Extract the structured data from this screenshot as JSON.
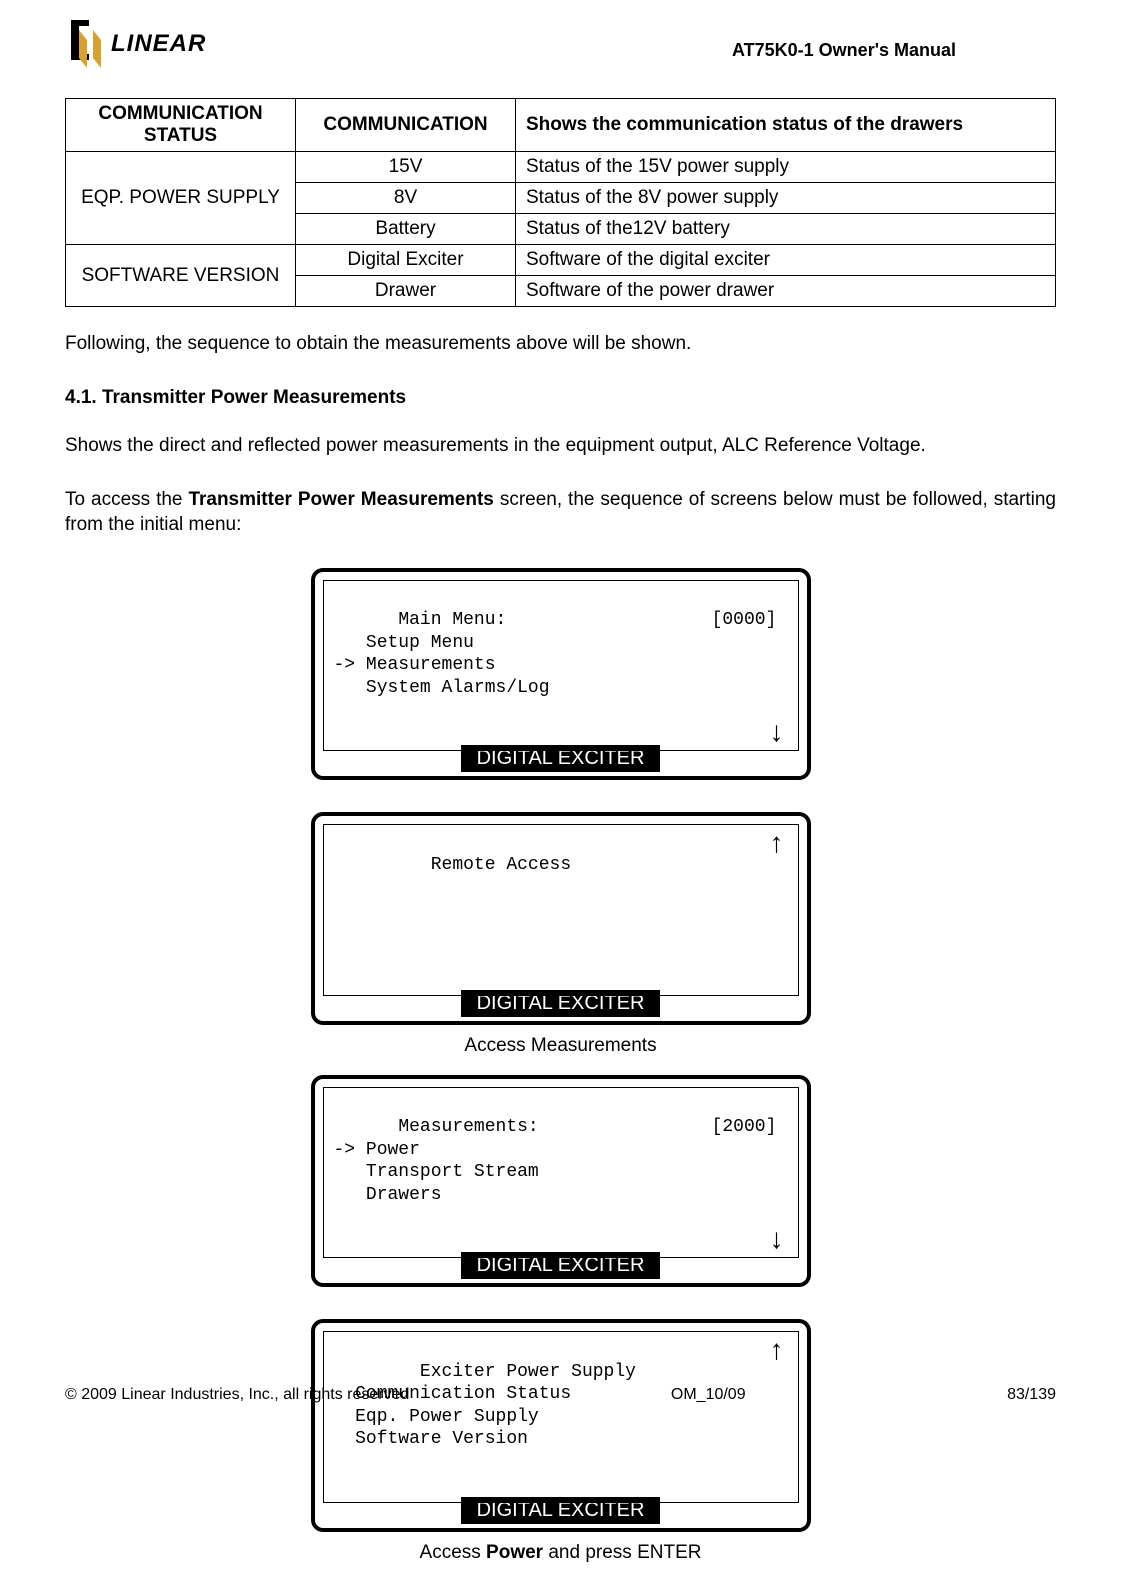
{
  "header": {
    "logo_text": "LINEAR",
    "doc_title": "AT75K0-1 Owner's Manual"
  },
  "table": {
    "rows": [
      {
        "col1": "COMMUNICATION STATUS",
        "col1_span": 1,
        "col1_bold": true,
        "col2": "COMMUNICATION",
        "col2_bold": true,
        "col3": "Shows the communication status of the drawers",
        "col3_bold": true
      },
      {
        "col1": "EQP. POWER SUPPLY",
        "col1_span": 3,
        "col2": "15V",
        "col3": "Status of the 15V power supply"
      },
      {
        "col2": "8V",
        "col3": "Status of the 8V power supply"
      },
      {
        "col2": "Battery",
        "col3": "Status of the12V battery"
      },
      {
        "col1": "SOFTWARE VERSION",
        "col1_span": 2,
        "col2": "Digital Exciter",
        "col3": "Software of the digital exciter"
      },
      {
        "col2": "Drawer",
        "col3": "Software of the power drawer"
      }
    ]
  },
  "body": {
    "p1": "Following, the sequence to obtain the measurements above will be shown.",
    "heading": "4.1. Transmitter Power Measurements",
    "p2": "Shows the direct and reflected power measurements in the equipment output, ALC Reference Voltage.",
    "p3a": "To access the ",
    "p3b": "Transmitter Power Measurements",
    "p3c": " screen, the sequence of screens below must be followed, starting from the initial menu:"
  },
  "screens": {
    "label": "DIGITAL EXCITER",
    "s1": "Main Menu:                   [0000]\n   Setup Menu\n-> Measurements\n   System Alarms/Log",
    "s2": "   Remote Access\n\n\n",
    "s3": "Measurements:                [2000]\n-> Power\n   Transport Stream\n   Drawers",
    "s4": "  Exciter Power Supply\n  Communication Status\n  Eqp. Power Supply\n  Software Version",
    "caption_mid": "Access Measurements",
    "caption_end_a": "Access ",
    "caption_end_b": "Power",
    "caption_end_c": " and press ENTER"
  },
  "footer": {
    "left": "© 2009 Linear Industries, Inc., all rights reserved",
    "mid": "OM_10/09",
    "right": "83/139"
  }
}
